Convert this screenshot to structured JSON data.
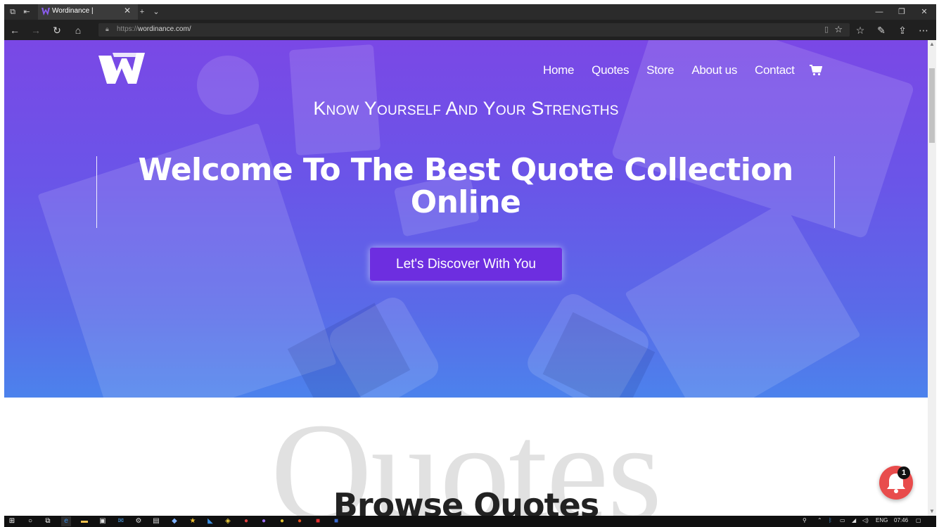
{
  "browser": {
    "tab_title": "Wordinance |",
    "url_protocol": "https://",
    "url_host": "wordinance.com/"
  },
  "site": {
    "nav": [
      "Home",
      "Quotes",
      "Store",
      "About us",
      "Contact"
    ],
    "tagline": "Know Yourself And Your Strengths",
    "headline_line1": "Welcome To The Best Quote Collection",
    "headline_line2": "Online",
    "cta_label": "Let's Discover With You",
    "bg_word": "Quotes",
    "section_title": "Browse Quotes",
    "notification_count": "1"
  },
  "taskbar": {
    "language": "ENG",
    "time": "07:46"
  },
  "colors": {
    "hero_top": "#7a48e6",
    "hero_bottom": "#4c82ec",
    "cta": "#6d2ee0",
    "bell": "#e84c4c"
  },
  "icons": [
    "tab-list-icon",
    "back-tabs-icon",
    "tab-close-icon",
    "new-tab-icon",
    "tab-chevron-icon",
    "back-icon",
    "forward-icon",
    "refresh-icon",
    "home-icon",
    "lock-icon",
    "reading-view-icon",
    "favorite-star-icon",
    "favorites-icon",
    "pen-icon",
    "share-icon",
    "more-icon",
    "cart-icon",
    "bell-icon",
    "windows-start-icon"
  ]
}
